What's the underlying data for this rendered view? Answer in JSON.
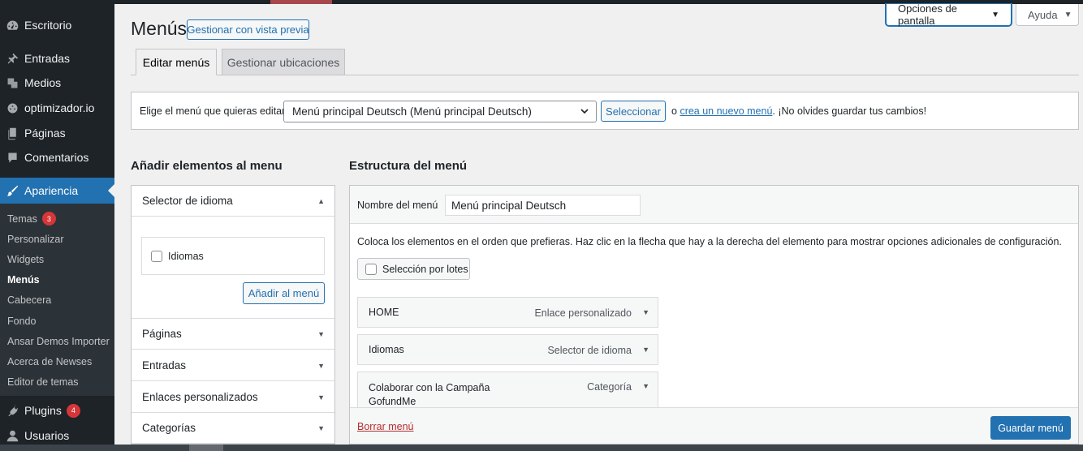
{
  "sidebar": {
    "items": [
      {
        "label": "Escritorio",
        "icon": "dashboard-icon"
      },
      {
        "label": "Entradas",
        "icon": "pin-icon"
      },
      {
        "label": "Medios",
        "icon": "media-icon"
      },
      {
        "label": "optimizador.io",
        "icon": "gauge-icon"
      },
      {
        "label": "Páginas",
        "icon": "page-icon"
      },
      {
        "label": "Comentarios",
        "icon": "comment-icon"
      },
      {
        "label": "Apariencia",
        "icon": "brush-icon"
      },
      {
        "label": "Plugins",
        "icon": "plug-icon",
        "badge": "4"
      },
      {
        "label": "Usuarios",
        "icon": "user-icon"
      }
    ],
    "submenu": [
      {
        "label": "Temas",
        "badge": "3"
      },
      {
        "label": "Personalizar"
      },
      {
        "label": "Widgets"
      },
      {
        "label": "Menús"
      },
      {
        "label": "Cabecera"
      },
      {
        "label": "Fondo"
      },
      {
        "label": "Ansar Demos Importer"
      },
      {
        "label": "Acerca de Newses"
      },
      {
        "label": "Editor de temas"
      }
    ]
  },
  "header": {
    "screen_options": "Opciones de pantalla",
    "help": "Ayuda",
    "title": "Menús",
    "preview_button": "Gestionar con vista previa"
  },
  "tabs": [
    {
      "label": "Editar menús",
      "active": true
    },
    {
      "label": "Gestionar ubicaciones",
      "active": false
    }
  ],
  "select_bar": {
    "label": "Elige el menú que quieras editar:",
    "selected": "Menú principal Deutsch (Menú principal Deutsch)",
    "button": "Seleccionar",
    "hint_prefix": "o",
    "hint_link": "crea un nuevo menú",
    "hint_suffix": ". ¡No olvides guardar tus cambios!"
  },
  "add_items": {
    "title": "Añadir elementos al menu",
    "language_section": "Selector de idioma",
    "language_option": "Idiomas",
    "add_button": "Añadir al menú",
    "sections": [
      "Páginas",
      "Entradas",
      "Enlaces personalizados",
      "Categorías"
    ]
  },
  "structure": {
    "title": "Estructura del menú",
    "name_label": "Nombre del menú",
    "name_value": "Menú principal Deutsch",
    "instructions": "Coloca los elementos en el orden que prefieras. Haz clic en la flecha que hay a la derecha del elemento para mostrar opciones adicionales de configuración.",
    "bulk_select": "Selección por lotes",
    "items": [
      {
        "title": "HOME",
        "type": "Enlace personalizado"
      },
      {
        "title": "Idiomas",
        "type": "Selector de idioma"
      },
      {
        "title": "Colaborar con la Campaña GofundMe",
        "type": "Categoría"
      }
    ],
    "delete": "Borrar menú",
    "save": "Guardar menú"
  },
  "colors": {
    "sidebar_bg": "#1d2327",
    "accent": "#2271b1",
    "badge": "#d63638",
    "delete": "#b32d2e"
  }
}
